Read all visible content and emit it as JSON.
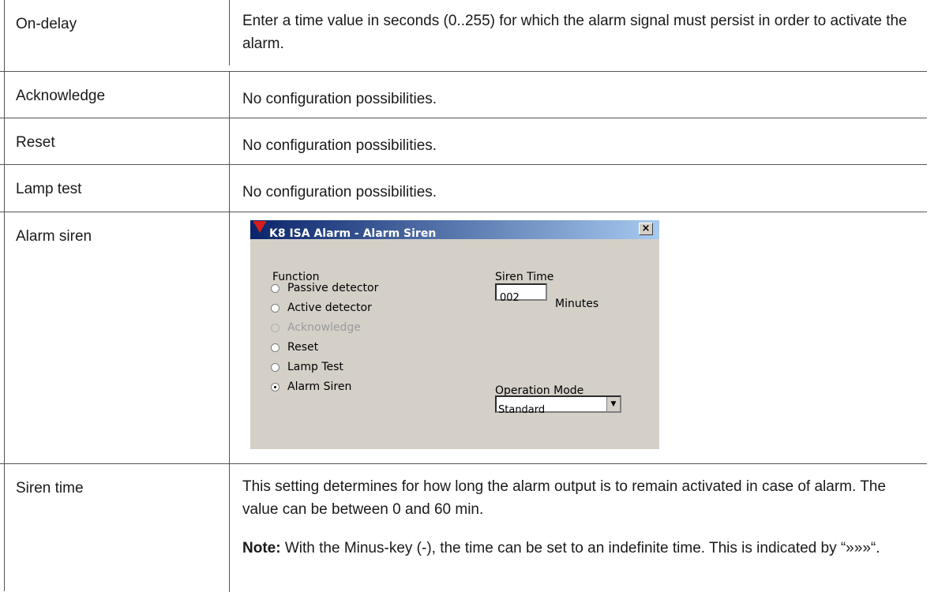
{
  "rows": [
    {
      "label": "On-delay",
      "text": "Enter a time value in seconds (0..255) for which the alarm signal must persist in order to activate the alarm."
    },
    {
      "label": "Acknowledge",
      "text": "No configuration possibilities."
    },
    {
      "label": "Reset",
      "text": "No configuration possibilities."
    },
    {
      "label": "Lamp test",
      "text": "No configuration possibilities."
    },
    {
      "label": "Alarm siren"
    },
    {
      "label": "Siren time",
      "text": "This setting determines for how long the alarm output is to remain activated in case of alarm. The value can be between 0 and 60 min.",
      "note_label": "Note:",
      "note_text": "With the Minus-key (-), the time can be set to an indefinite time. This is indicated by “»»»“."
    }
  ],
  "dialog": {
    "title": "K8   ISA Alarm - Alarm Siren",
    "close_glyph": "×",
    "function_label": "Function",
    "options": [
      "Passive detector",
      "Active detector",
      "Acknowledge",
      "Reset",
      "Lamp Test",
      "Alarm Siren"
    ],
    "selected_option": "Alarm Siren",
    "disabled_option": "Acknowledge",
    "siren_time_label": "Siren Time",
    "siren_time_value": "002",
    "siren_time_unit": "Minutes",
    "operation_mode_label": "Operation Mode",
    "operation_mode_value": "Standard",
    "dropdown_glyph": "▼"
  },
  "colors": {
    "title_bar": "#0a246a",
    "dialog_bg": "#d4d0c8",
    "logo_red": "#d21e1e"
  }
}
